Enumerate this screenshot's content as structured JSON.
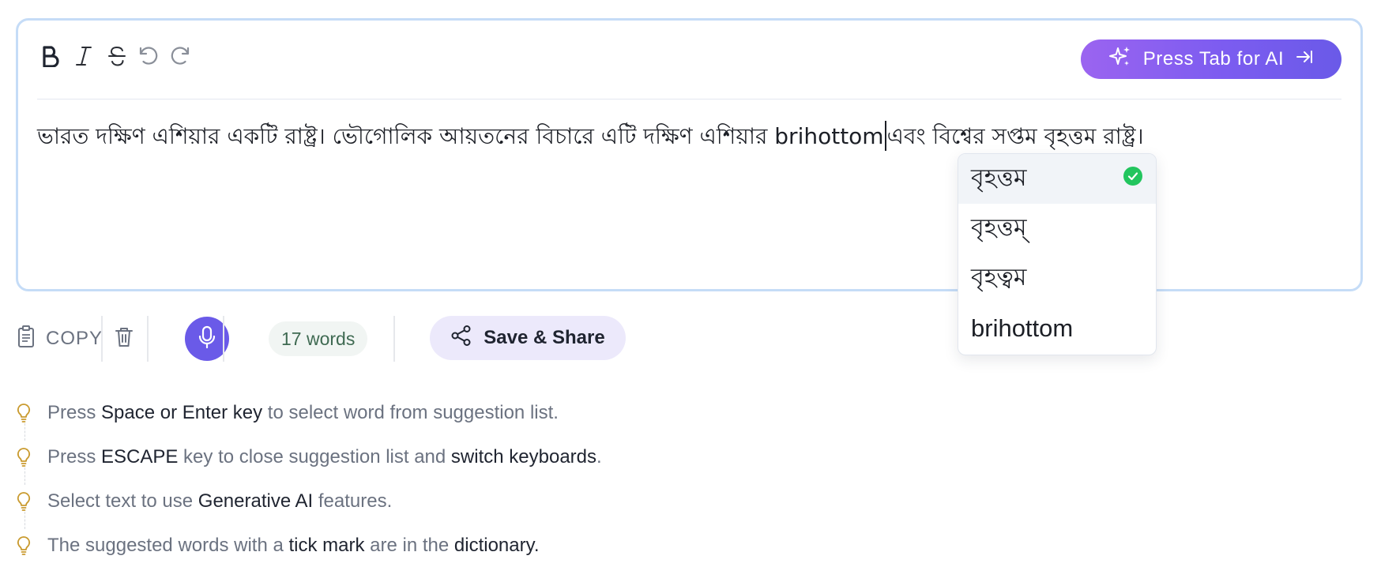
{
  "toolbar": {
    "bold_icon": "bold-icon",
    "italic_icon": "italic-icon",
    "strikethrough_icon": "strikethrough-icon",
    "undo_icon": "undo-icon",
    "redo_icon": "redo-icon",
    "ai_button_label": "Press Tab for AI",
    "ai_button_colors": [
      "#9b64f0",
      "#6a5ae8"
    ]
  },
  "editor": {
    "text_before_caret": "ভারত দক্ষিণ এশিয়ার একটি রাষ্ট্র। ভৌগোলিক আয়তনের বিচারে এটি দক্ষিণ এশিয়ার brihottom",
    "text_after_caret": "এবং বিশ্বের সপ্তম বৃহত্তম রাষ্ট্র।"
  },
  "suggestions": [
    {
      "text": "বৃহত্তম",
      "in_dictionary": true,
      "selected": true
    },
    {
      "text": "বৃহত্তম্",
      "in_dictionary": false,
      "selected": false
    },
    {
      "text": "বৃহত্বম",
      "in_dictionary": false,
      "selected": false
    },
    {
      "text": "brihottom",
      "in_dictionary": false,
      "selected": false
    }
  ],
  "bottom_bar": {
    "copy_label": "COPY",
    "word_count": "17 words",
    "save_share_label": "Save & Share",
    "accent_color": "#6a5ae8"
  },
  "tips": [
    {
      "parts": [
        [
          "Press ",
          false
        ],
        [
          "Space or Enter key",
          true
        ],
        [
          " to select word from suggestion list.",
          false
        ]
      ]
    },
    {
      "parts": [
        [
          "Press ",
          false
        ],
        [
          "ESCAPE",
          true
        ],
        [
          " key to close suggestion list and ",
          false
        ],
        [
          "switch keyboards",
          true
        ],
        [
          ".",
          false
        ]
      ]
    },
    {
      "parts": [
        [
          "Select text to use ",
          false
        ],
        [
          "Generative AI",
          true
        ],
        [
          " features.",
          false
        ]
      ]
    },
    {
      "parts": [
        [
          "The suggested words with a ",
          false
        ],
        [
          "tick mark",
          true
        ],
        [
          " are in the ",
          false
        ],
        [
          "dictionary.",
          true
        ]
      ]
    }
  ]
}
